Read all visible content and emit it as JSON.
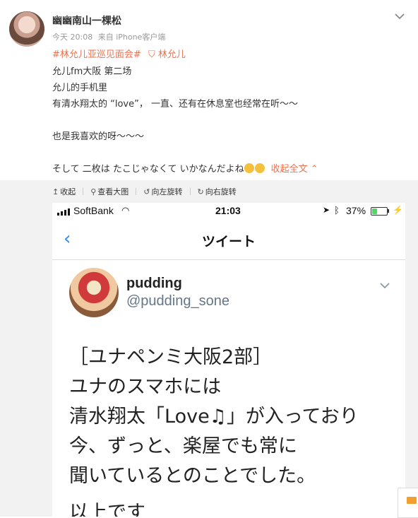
{
  "post": {
    "username": "幽幽南山一棵松",
    "meta": {
      "time": "今天 20:08",
      "source": "来自 iPhone客户端"
    },
    "tags": {
      "topic": "#林允儿亚巡见面会#",
      "person": "林允儿"
    },
    "lines": [
      "允儿fm大阪 第二场",
      "允儿的手机里",
      "有清水翔太的 “love”， 一直、还有在休息室也经常在听～～",
      "",
      "也是我喜欢的呀～～～",
      "",
      "そして 二枚は たこじゃなくて いかなんだよね"
    ],
    "collapse_label": "收起全文"
  },
  "toolbar": {
    "items": [
      {
        "icon": "↥",
        "label": "收起"
      },
      {
        "icon": "⚲",
        "label": "查看大图"
      },
      {
        "icon": "↺",
        "label": "向左旋转"
      },
      {
        "icon": "↻",
        "label": "向右旋转"
      }
    ]
  },
  "phone": {
    "carrier": "SoftBank",
    "time": "21:03",
    "battery": "37%",
    "battery_level": 0.37,
    "nav_title": "ツイート",
    "tweet": {
      "name": "pudding",
      "handle": "@pudding_sone",
      "lines": [
        "［ユナペンミ大阪2部］",
        "ユナのスマホには",
        "清水翔太「Love♫」が入っており",
        "今、ずっと、楽屋でも常に",
        "聞いているとのことでした。"
      ],
      "last_line": "以上です"
    }
  }
}
